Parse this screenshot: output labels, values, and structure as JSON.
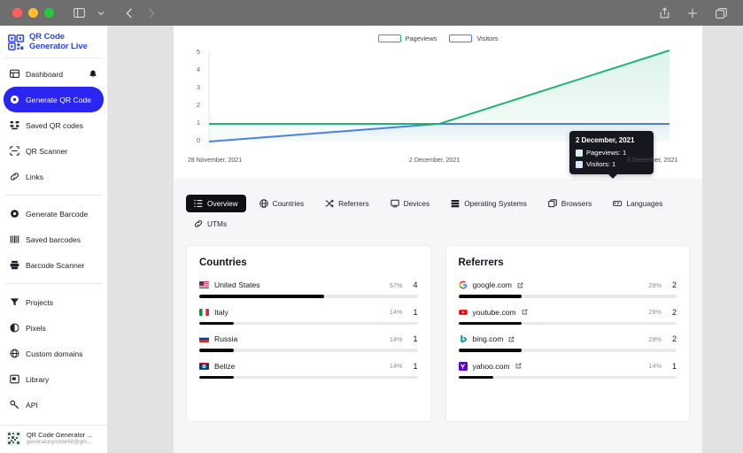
{
  "browser": {
    "traffic_lights": [
      "close",
      "minimize",
      "maximize"
    ],
    "sidebar_toggle": "sidebar-toggle",
    "back": "back-arrow",
    "forward": "forward-arrow",
    "share": "share-icon",
    "new_tab": "plus-icon",
    "tab_overview": "tabs-icon"
  },
  "sidebar": {
    "logo": {
      "line1": "QR Code",
      "line2": "Generator Live"
    },
    "items": [
      {
        "label": "Dashboard",
        "icon": "dashboard-icon",
        "active": false,
        "badge_icon": "bell-icon"
      },
      {
        "label": "Generate QR Code",
        "icon": "qr-generate-icon",
        "active": true
      },
      {
        "label": "Saved QR codes",
        "icon": "saved-qr-icon",
        "active": false
      },
      {
        "label": "QR Scanner",
        "icon": "qr-scanner-icon",
        "active": false
      },
      {
        "label": "Links",
        "icon": "link-icon",
        "active": false
      },
      {
        "label": "Generate Barcode",
        "icon": "barcode-generate-icon",
        "active": false
      },
      {
        "label": "Saved barcodes",
        "icon": "saved-barcode-icon",
        "active": false
      },
      {
        "label": "Barcode Scanner",
        "icon": "barcode-scanner-icon",
        "active": false
      },
      {
        "label": "Projects",
        "icon": "projects-icon",
        "active": false
      },
      {
        "label": "Pixels",
        "icon": "pixels-icon",
        "active": false
      },
      {
        "label": "Custom domains",
        "icon": "globe-icon",
        "active": false
      },
      {
        "label": "Library",
        "icon": "library-icon",
        "active": false
      },
      {
        "label": "API",
        "icon": "key-icon",
        "active": false
      }
    ],
    "account": {
      "name": "QR Code Generator ...",
      "email": "generatorqrcode68@gm...",
      "avatar": "qr-avatar"
    },
    "active_color": "#2a25f0",
    "logo_color": "#2a47e8"
  },
  "chart_data": {
    "type": "area",
    "title": "",
    "xlabel": "",
    "ylabel": "",
    "x": [
      "28 November, 2021",
      "2 December, 2021",
      "6 December, 2021"
    ],
    "tick_labels": [
      "28 November, 2021",
      "2 December, 2021",
      "6 December, 2021"
    ],
    "y_ticks": [
      0,
      1,
      2,
      3,
      4,
      5
    ],
    "ylim": [
      0,
      5
    ],
    "grid": false,
    "legend_position": "top-center",
    "series": [
      {
        "name": "Pageviews",
        "color": "#21b573",
        "values": [
          1,
          1,
          5
        ]
      },
      {
        "name": "Visitors",
        "color": "#4d7fe6",
        "values": [
          0,
          1,
          1
        ]
      }
    ],
    "tooltip": {
      "title": "2 December, 2021",
      "rows": [
        {
          "label": "Pageviews",
          "value": "1"
        },
        {
          "label": "Visitors",
          "value": "1"
        }
      ]
    }
  },
  "tabs": [
    {
      "label": "Overview",
      "icon": "list-icon",
      "active": true
    },
    {
      "label": "Countries",
      "icon": "globe-icon",
      "active": false
    },
    {
      "label": "Referrers",
      "icon": "shuffle-icon",
      "active": false
    },
    {
      "label": "Devices",
      "icon": "monitor-icon",
      "active": false
    },
    {
      "label": "Operating Systems",
      "icon": "server-icon",
      "active": false
    },
    {
      "label": "Browsers",
      "icon": "window-icon",
      "active": false
    },
    {
      "label": "Languages",
      "icon": "translate-icon",
      "active": false
    },
    {
      "label": "UTMs",
      "icon": "link-icon",
      "active": false
    }
  ],
  "countries_panel": {
    "title": "Countries",
    "rows": [
      {
        "label": "United States",
        "pct": "57%",
        "value": "4",
        "bar": 57,
        "flag": "us-flag"
      },
      {
        "label": "Italy",
        "pct": "14%",
        "value": "1",
        "bar": 14,
        "flag": "it-flag"
      },
      {
        "label": "Russia",
        "pct": "14%",
        "value": "1",
        "bar": 14,
        "flag": "ru-flag"
      },
      {
        "label": "Belize",
        "pct": "14%",
        "value": "1",
        "bar": 14,
        "flag": "bz-flag"
      }
    ]
  },
  "referrers_panel": {
    "title": "Referrers",
    "rows": [
      {
        "label": "google.com",
        "pct": "29%",
        "value": "2",
        "bar": 29,
        "favicon": "google-favicon"
      },
      {
        "label": "youtube.com",
        "pct": "29%",
        "value": "2",
        "bar": 29,
        "favicon": "youtube-favicon"
      },
      {
        "label": "bing.com",
        "pct": "29%",
        "value": "2",
        "bar": 29,
        "favicon": "bing-favicon"
      },
      {
        "label": "yahoo.com",
        "pct": "14%",
        "value": "1",
        "bar": 14,
        "favicon": "yahoo-favicon"
      }
    ]
  }
}
